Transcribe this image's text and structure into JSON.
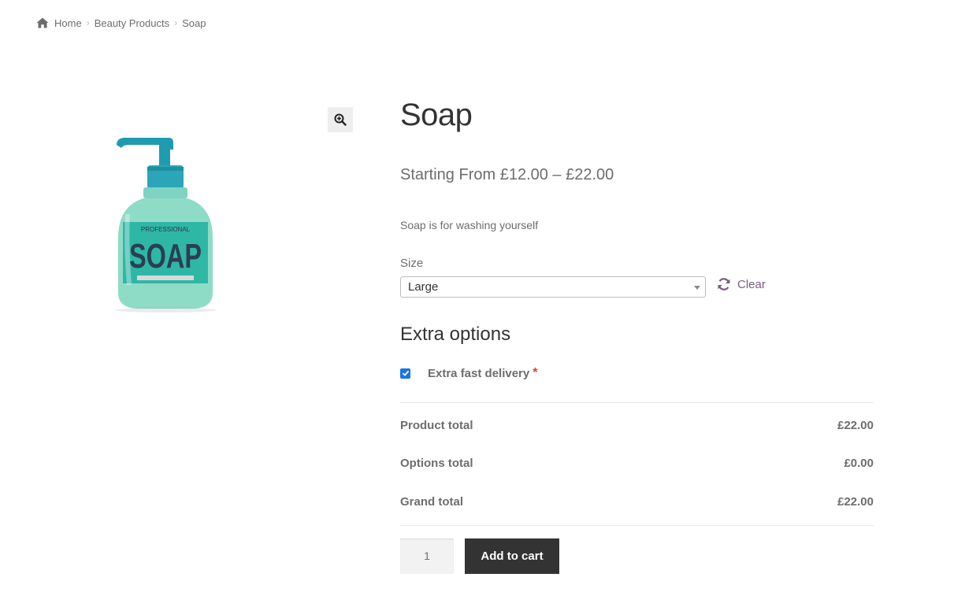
{
  "breadcrumb": {
    "home": "Home",
    "category": "Beauty Products",
    "current": "Soap",
    "separator": "›"
  },
  "gallery": {
    "zoom_icon": "zoom-in-icon",
    "image_alt": "Soap product bottle",
    "image_text_brand": "PROFESSIONAL",
    "image_text_main": "SOAP"
  },
  "product": {
    "title": "Soap",
    "price": "Starting From £12.00 – £22.00",
    "short_description": "Soap is for washing yourself"
  },
  "variation": {
    "label": "Size",
    "selected": "Large",
    "clear_label": "Clear"
  },
  "extra_options": {
    "heading": "Extra options",
    "option_label": "Extra fast delivery",
    "required_marker": "*",
    "checked": true
  },
  "totals": {
    "product_total_label": "Product total",
    "product_total_value": "£22.00",
    "options_total_label": "Options total",
    "options_total_value": "£0.00",
    "grand_total_label": "Grand total",
    "grand_total_value": "£22.00"
  },
  "cart": {
    "quantity": "1",
    "add_to_cart_label": "Add to cart"
  },
  "colors": {
    "text": "#6d6d6d",
    "heading": "#333333",
    "clear_link": "#7b5c7d",
    "checkbox": "#1a73e8",
    "required": "#e2401c",
    "button_bg": "#333333"
  }
}
